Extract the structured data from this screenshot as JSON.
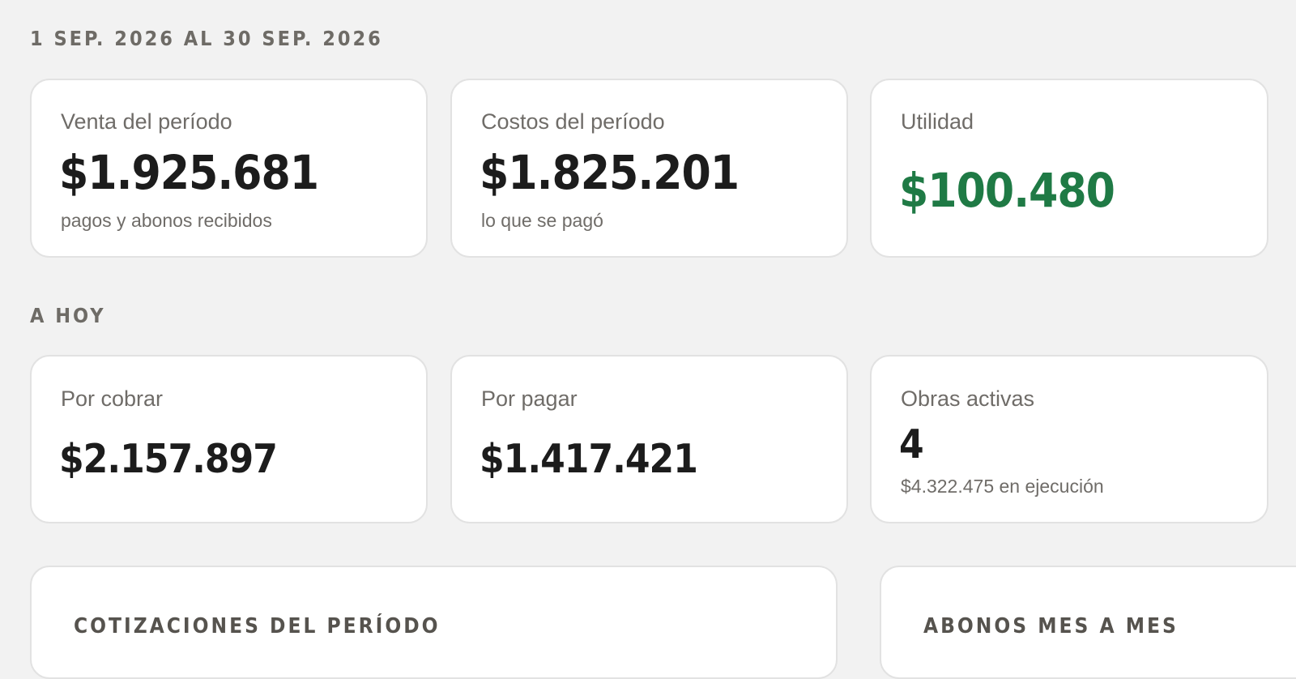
{
  "period": {
    "label": "1 SEP. 2026 AL 30 SEP. 2026",
    "cards": [
      {
        "label": "Venta del período",
        "value": "$1.925.681",
        "sub": "pagos y abonos recibidos"
      },
      {
        "label": "Costos del período",
        "value": "$1.825.201",
        "sub": "lo que se pagó"
      },
      {
        "label": "Utilidad",
        "value": "$100.480",
        "value_color": "#1f7a45"
      }
    ]
  },
  "today": {
    "label": "A HOY",
    "cards": [
      {
        "label": "Por cobrar",
        "value": "$2.157.897"
      },
      {
        "label": "Por pagar",
        "value": "$1.417.421"
      },
      {
        "label": "Obras activas",
        "value": "4",
        "sub": "$4.322.475 en ejecución"
      }
    ]
  },
  "panels": {
    "quotes_title": "COTIZACIONES DEL PERÍODO",
    "payments_title": "ABONOS MES A MES"
  },
  "colors": {
    "background": "#f2f2f2",
    "card": "#ffffff",
    "positive": "#1f7a45"
  }
}
